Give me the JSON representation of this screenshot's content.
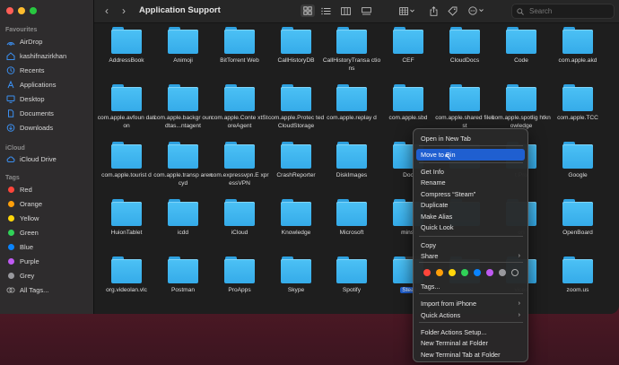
{
  "window": {
    "title": "Application Support"
  },
  "sidebar": {
    "favourites_label": "Favourites",
    "favourites": [
      {
        "label": "AirDrop",
        "icon": "airdrop-icon"
      },
      {
        "label": "kashifnazirkhan",
        "icon": "home-icon"
      },
      {
        "label": "Recents",
        "icon": "clock-icon"
      },
      {
        "label": "Applications",
        "icon": "applications-icon"
      },
      {
        "label": "Desktop",
        "icon": "desktop-icon"
      },
      {
        "label": "Documents",
        "icon": "document-icon"
      },
      {
        "label": "Downloads",
        "icon": "download-icon"
      }
    ],
    "icloud_label": "iCloud",
    "icloud": [
      {
        "label": "iCloud Drive",
        "icon": "cloud-icon"
      }
    ],
    "tags_label": "Tags",
    "tags": [
      {
        "label": "Red",
        "color": "#ff453a"
      },
      {
        "label": "Orange",
        "color": "#ff9f0a"
      },
      {
        "label": "Yellow",
        "color": "#ffd60a"
      },
      {
        "label": "Green",
        "color": "#30d158"
      },
      {
        "label": "Blue",
        "color": "#0a84ff"
      },
      {
        "label": "Purple",
        "color": "#bf5af2"
      },
      {
        "label": "Grey",
        "color": "#98989d"
      },
      {
        "label": "All Tags...",
        "color": ""
      }
    ]
  },
  "toolbar": {
    "back_icon": "chevron-left-icon",
    "forward_icon": "chevron-right-icon",
    "search_placeholder": "Search"
  },
  "folders": [
    {
      "name": "AddressBook"
    },
    {
      "name": "Animoji"
    },
    {
      "name": "BitTorrent Web"
    },
    {
      "name": "CallHistoryDB"
    },
    {
      "name": "CallHistoryTransa ctions"
    },
    {
      "name": "CEF"
    },
    {
      "name": "CloudDocs"
    },
    {
      "name": "Code"
    },
    {
      "name": "com.apple.akd"
    },
    {
      "name": "com.apple.avfoun dation"
    },
    {
      "name": "com.apple.backgr oundtas...ntagent"
    },
    {
      "name": "com.apple.Conte xtStoreAgent"
    },
    {
      "name": "com.apple.Protec tedCloudStorage"
    },
    {
      "name": "com.apple.replay d"
    },
    {
      "name": "com.apple.sbd"
    },
    {
      "name": "com.apple.shared filelist"
    },
    {
      "name": "com.apple.spotlig htknowledge"
    },
    {
      "name": "com.apple.TCC"
    },
    {
      "name": "com.apple.tourist d"
    },
    {
      "name": "com.apple.transp arencyd"
    },
    {
      "name": "com.expressvpn.E xpressVPN"
    },
    {
      "name": "CrashReporter"
    },
    {
      "name": "DiskImages"
    },
    {
      "name": "Doc"
    },
    {
      "name": ""
    },
    {
      "name": "t Pro"
    },
    {
      "name": "Google"
    },
    {
      "name": "HuionTablet"
    },
    {
      "name": "icdd"
    },
    {
      "name": "iCloud"
    },
    {
      "name": "Knowledge"
    },
    {
      "name": "Microsoft"
    },
    {
      "name": "minst"
    },
    {
      "name": ""
    },
    {
      "name": "on"
    },
    {
      "name": "OpenBoard"
    },
    {
      "name": "org.videolan.vlc"
    },
    {
      "name": "Postman"
    },
    {
      "name": "ProApps"
    },
    {
      "name": "Skype"
    },
    {
      "name": "Spotify"
    },
    {
      "name": "Stea",
      "selected": true
    },
    {
      "name": ""
    },
    {
      "name": "vices"
    },
    {
      "name": "zoom.us"
    }
  ],
  "context_menu": {
    "items": [
      {
        "label": "Open in New Tab"
      },
      {
        "label": "Move to Bin",
        "highlighted": true
      },
      {
        "label": "Get Info"
      },
      {
        "label": "Rename"
      },
      {
        "label": "Compress “Steam”"
      },
      {
        "label": "Duplicate"
      },
      {
        "label": "Make Alias"
      },
      {
        "label": "Quick Look"
      },
      {
        "label": "Copy"
      },
      {
        "label": "Share",
        "submenu": true
      },
      {
        "label": "Tags..."
      },
      {
        "label": "Import from iPhone",
        "submenu": true
      },
      {
        "label": "Quick Actions",
        "submenu": true
      },
      {
        "label": "Folder Actions Setup..."
      },
      {
        "label": "New Terminal at Folder"
      },
      {
        "label": "New Terminal Tab at Folder"
      }
    ],
    "tag_colors": [
      "#ff453a",
      "#ff9f0a",
      "#ffd60a",
      "#30d158",
      "#0a84ff",
      "#bf5af2",
      "#98989d"
    ],
    "submenu_arrow": "›"
  }
}
